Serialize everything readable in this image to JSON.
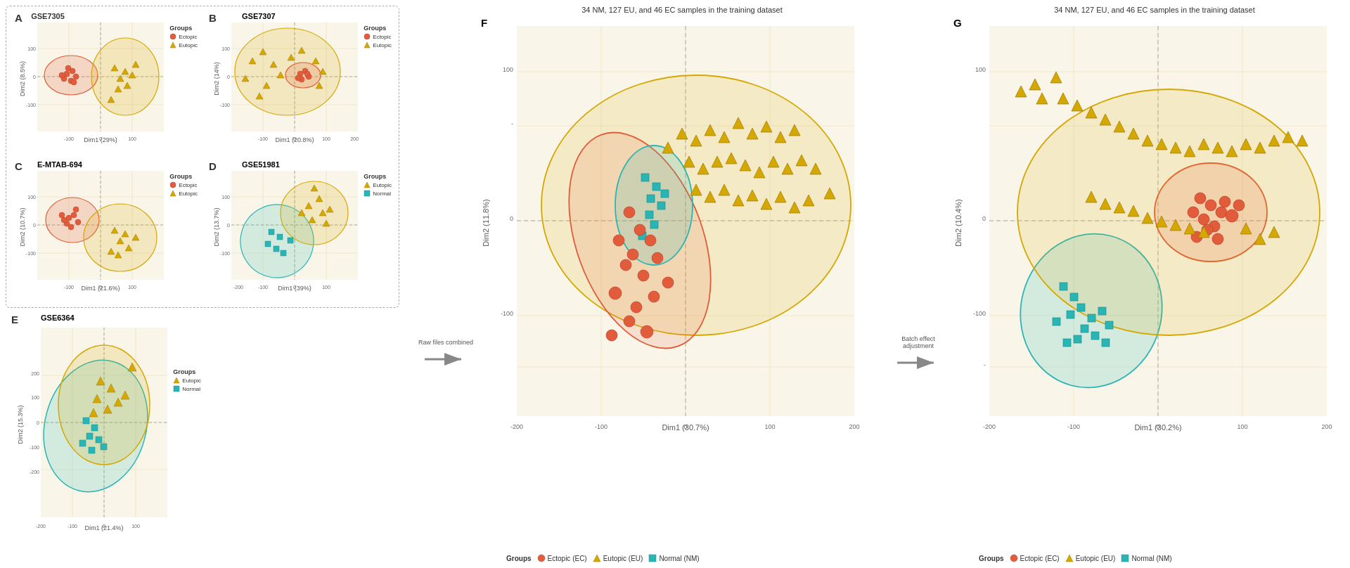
{
  "panels": {
    "A": {
      "label": "A",
      "title": "GSE7305",
      "xAxis": "Dim1 (29%)",
      "yAxis": "Dim2 (8.5%)",
      "legend": {
        "title": "Groups",
        "items": [
          {
            "label": "Ectopic",
            "color": "#e05c3a",
            "shape": "circle"
          },
          {
            "label": "Eutopic",
            "color": "#d4a800",
            "shape": "triangle"
          }
        ]
      }
    },
    "B": {
      "label": "B",
      "title": "GSE7307",
      "xAxis": "Dim1 (20.8%)",
      "yAxis": "Dim2 (14%)",
      "legend": {
        "title": "Groups",
        "items": [
          {
            "label": "Ectopic",
            "color": "#e05c3a",
            "shape": "circle"
          },
          {
            "label": "Eutopic",
            "color": "#d4a800",
            "shape": "triangle"
          }
        ]
      }
    },
    "C": {
      "label": "C",
      "title": "E-MTAB-694",
      "xAxis": "Dim1 (21.6%)",
      "yAxis": "Dim2 (10.7%)",
      "legend": {
        "title": "Groups",
        "items": [
          {
            "label": "Ectopic",
            "color": "#e05c3a",
            "shape": "circle"
          },
          {
            "label": "Eutopic",
            "color": "#d4a800",
            "shape": "triangle"
          }
        ]
      }
    },
    "D": {
      "label": "D",
      "title": "GSE51981",
      "xAxis": "Dim1 (39%)",
      "yAxis": "Dim2 (13.7%)",
      "legend": {
        "title": "Groups",
        "items": [
          {
            "label": "Eutopic",
            "color": "#d4a800",
            "shape": "triangle"
          },
          {
            "label": "Normal",
            "color": "#2ab5b5",
            "shape": "square"
          }
        ]
      }
    },
    "E": {
      "label": "E",
      "title": "GSE6364",
      "xAxis": "Dim1 (21.4%)",
      "yAxis": "Dim2 (15.3%)",
      "legend": {
        "title": "Groups",
        "items": [
          {
            "label": "Eutopic",
            "color": "#d4a800",
            "shape": "triangle"
          },
          {
            "label": "Normal",
            "color": "#2ab5b5",
            "shape": "square"
          }
        ]
      }
    },
    "F": {
      "label": "F",
      "title": "34 NM, 127 EU, and 46 EC samples in the training dataset",
      "xAxis": "Dim1 (30.7%)",
      "yAxis": "Dim2 (11.8%)",
      "arrowLabel": "Raw files combined",
      "legend": {
        "title": "Groups",
        "items": [
          {
            "label": "Ectopic (EC)",
            "color": "#e05c3a",
            "shape": "circle"
          },
          {
            "label": "Eutopic (EU)",
            "color": "#d4a800",
            "shape": "triangle"
          },
          {
            "label": "Normal (NM)",
            "color": "#2ab5b5",
            "shape": "square"
          }
        ]
      }
    },
    "G": {
      "label": "G",
      "title": "34 NM, 127 EU, and 46 EC samples in the training dataset",
      "xAxis": "Dim1 (30.2%)",
      "yAxis": "Dim2 (10.4%)",
      "arrowLabel": "Batch effect adjustment",
      "legend": {
        "title": "Groups",
        "items": [
          {
            "label": "Ectopic (EC)",
            "color": "#e05c3a",
            "shape": "circle"
          },
          {
            "label": "Eutopic (EU)",
            "color": "#d4a800",
            "shape": "triangle"
          },
          {
            "label": "Normal (NM)",
            "color": "#2ab5b5",
            "shape": "square"
          }
        ]
      }
    }
  },
  "colors": {
    "ectopic": "#e05c3a",
    "eutopic": "#d4a800",
    "normal": "#2ab5b5",
    "ellipse_ectopic": "rgba(224,92,58,0.18)",
    "ellipse_eutopic": "rgba(212,168,0,0.18)",
    "ellipse_normal": "rgba(42,181,181,0.18)",
    "grid_bg": "#f9f5e8",
    "grid_line": "#e0d8b0"
  }
}
